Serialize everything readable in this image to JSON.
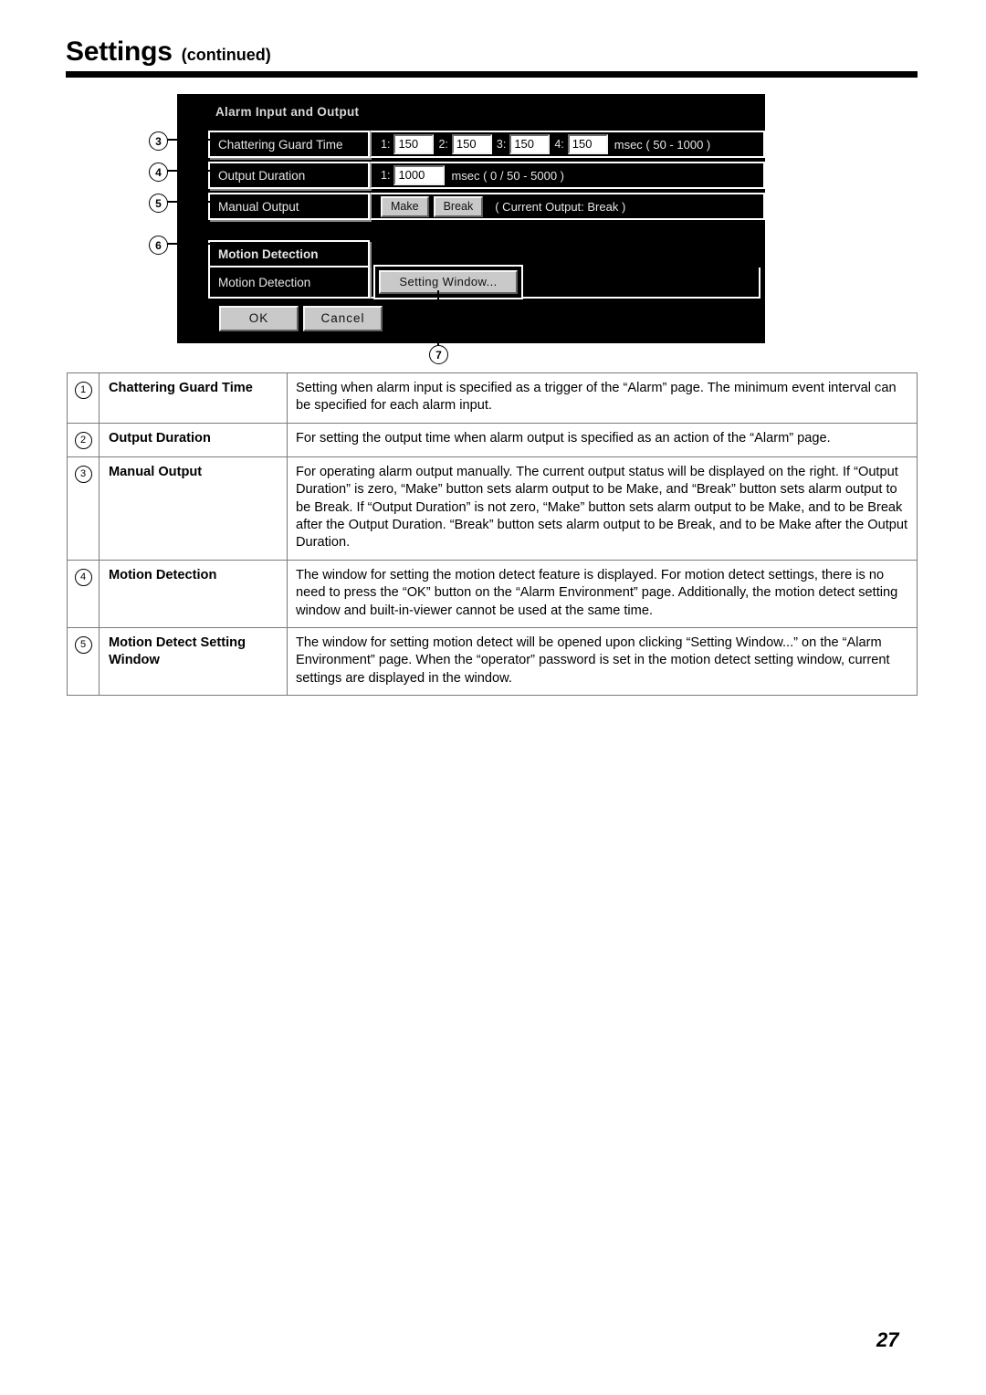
{
  "page": {
    "title_main": "Settings",
    "title_sub": "(continued)",
    "page_number": "27"
  },
  "dialog": {
    "title": "Alarm Input and Output",
    "rows": [
      {
        "callout": "3",
        "label": "Chattering Guard Time",
        "fields": [
          {
            "index": "1:",
            "value": "150"
          },
          {
            "index": "2:",
            "value": "150"
          },
          {
            "index": "3:",
            "value": "150"
          },
          {
            "index": "4:",
            "value": "150"
          }
        ],
        "unit": "msec ( 50 - 1000 )"
      },
      {
        "callout": "4",
        "label": "Output Duration",
        "fields": [
          {
            "index": "1:",
            "value": "1000"
          }
        ],
        "unit": "msec ( 0 / 50 - 5000 )"
      },
      {
        "callout": "5",
        "label": "Manual Output",
        "buttons": [
          {
            "label": "Make"
          },
          {
            "label": "Break"
          }
        ],
        "status": "( Current Output: Break )"
      }
    ],
    "motion_section": {
      "callout": "6",
      "header_label": "Motion Detection",
      "row_label": "Motion Detection",
      "setting_button": "Setting Window...",
      "setting_button_callout": "7"
    },
    "footer_buttons": [
      {
        "label": "OK"
      },
      {
        "label": "Cancel"
      }
    ]
  },
  "description_table": {
    "rows": [
      {
        "num": "1",
        "term": "Chattering Guard Time",
        "text": "Setting when alarm input is specified as a trigger of the “Alarm” page. The minimum event interval can be specified for each alarm input."
      },
      {
        "num": "2",
        "term": "Output Duration",
        "text": "For setting the output time when alarm output is specified as an action of the “Alarm” page."
      },
      {
        "num": "3",
        "term": "Manual Output",
        "text": "For operating alarm output manually. The current output status will be displayed on the right. If “Output Duration” is zero, “Make” button sets alarm output to be Make, and “Break” button sets alarm output to be Break. If “Output Duration” is not zero, “Make” button sets alarm output to be Make, and to be Break after the Output Duration. “Break” button sets alarm output to be Break, and to be Make after the Output Duration."
      },
      {
        "num": "4",
        "term": "Motion Detection",
        "text": "The window for setting the motion detect feature is displayed. For motion detect settings, there is no need to press the “OK” button on the “Alarm Environment” page. Additionally, the motion detect setting window and built-in-viewer cannot be used at the same time."
      },
      {
        "num": "5",
        "term": "Motion Detect Setting Window",
        "text": "The window for setting motion detect will be opened upon clicking “Setting Window...” on the “Alarm Environment” page. When the “operator” password is set in the motion detect setting window, current settings are displayed in the window."
      }
    ]
  }
}
